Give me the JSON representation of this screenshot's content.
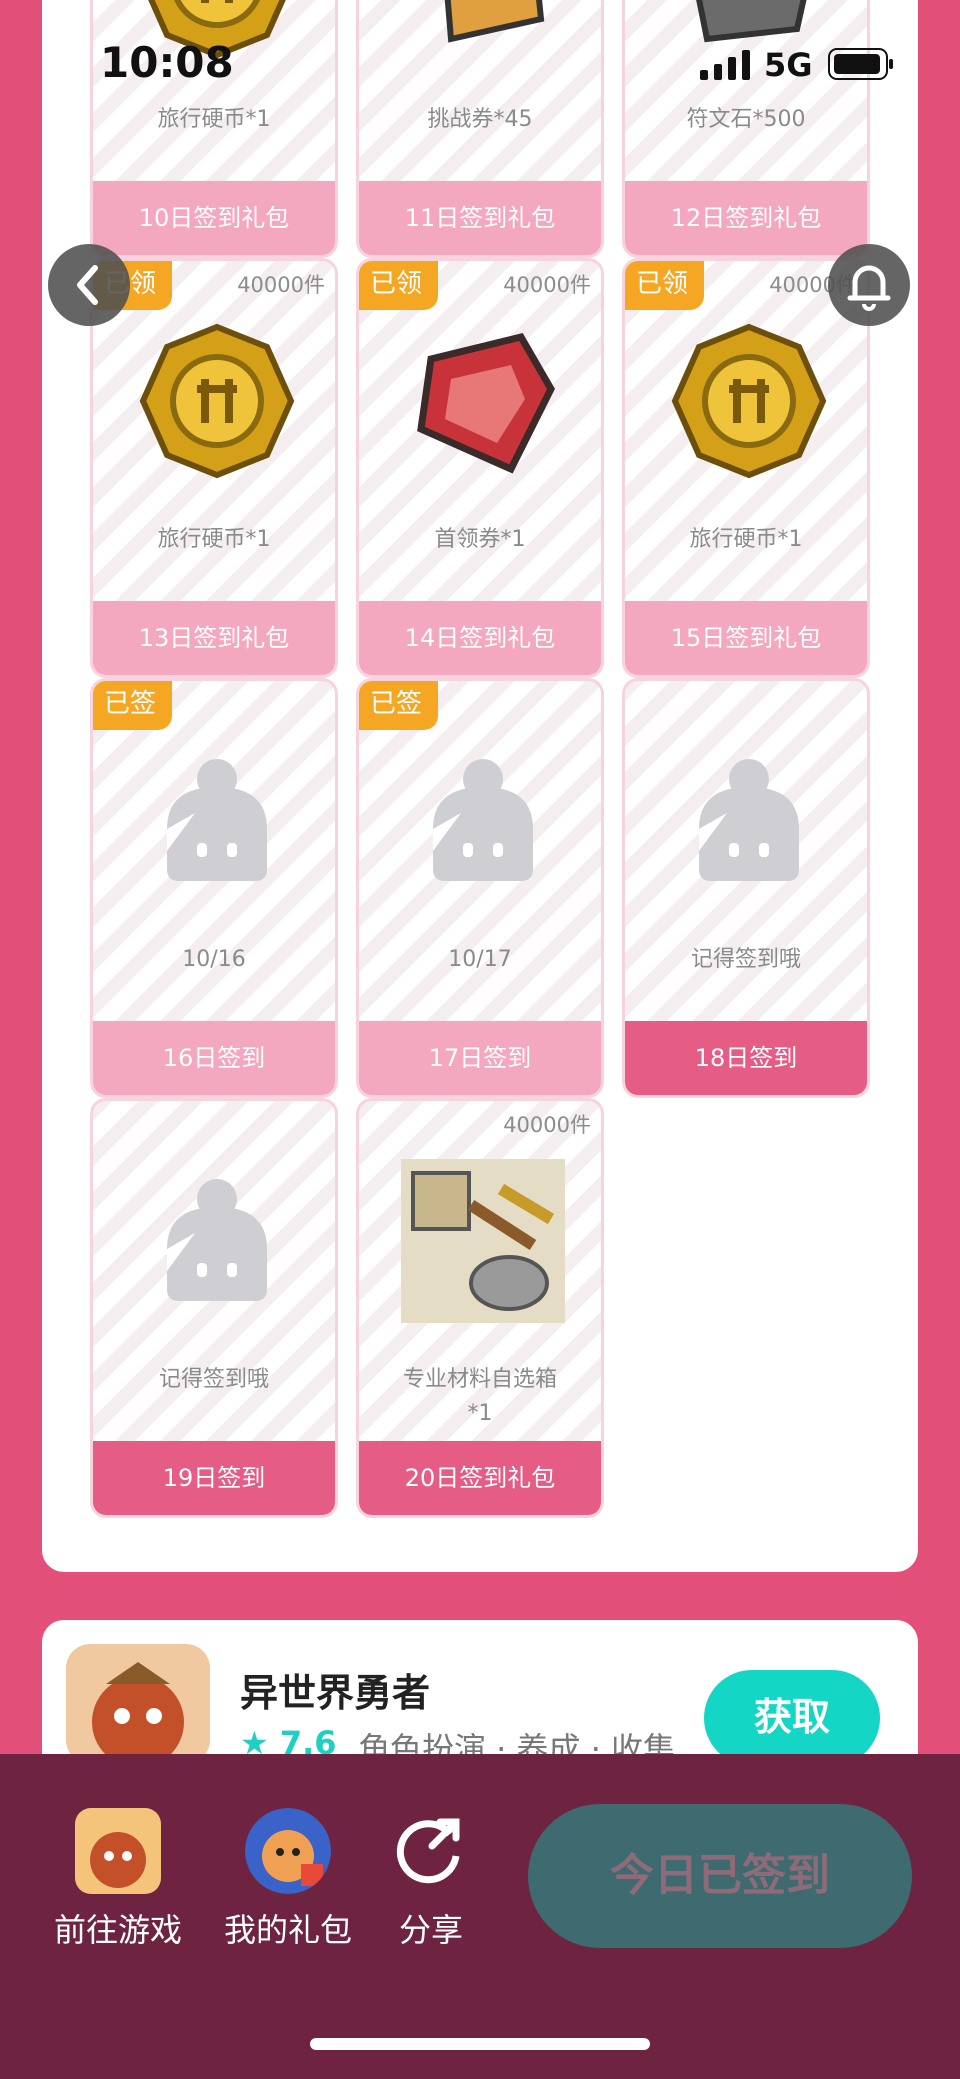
{
  "status_bar": {
    "time": "10:08",
    "network": "5G"
  },
  "rewards": [
    {
      "item": "旅行硬币*1",
      "bar": "10日签到礼包",
      "icon": "coin-icon"
    },
    {
      "item": "挑战券*45",
      "bar": "11日签到礼包",
      "icon": "ticket-icon"
    },
    {
      "item": "符文石*500",
      "bar": "12日签到礼包",
      "icon": "rune-stone-icon"
    },
    {
      "tag": "已领",
      "qty": "40000件",
      "item": "旅行硬币*1",
      "bar": "13日签到礼包",
      "icon": "coin-icon"
    },
    {
      "tag": "已领",
      "qty": "40000件",
      "item": "首领券*1",
      "bar": "14日签到礼包",
      "icon": "boss-ticket-icon"
    },
    {
      "tag": "已领",
      "qty": "40000件",
      "item": "旅行硬币*1",
      "bar": "15日签到礼包",
      "icon": "coin-icon"
    },
    {
      "tag": "已签",
      "item": "10/16",
      "bar": "16日签到",
      "icon": "placeholder-avatar-icon"
    },
    {
      "tag": "已签",
      "item": "10/17",
      "bar": "17日签到",
      "icon": "placeholder-avatar-icon"
    },
    {
      "item": "记得签到哦",
      "bar": "18日签到",
      "icon": "placeholder-avatar-icon",
      "active": true
    },
    {
      "item": "记得签到哦",
      "bar": "19日签到",
      "icon": "placeholder-avatar-icon",
      "active": true
    },
    {
      "qty": "40000件",
      "item": "专业材料自选箱\n*1",
      "bar": "20日签到礼包",
      "icon": "material-box-icon",
      "active": true
    }
  ],
  "game": {
    "name": "异世界勇者",
    "rating": "7.6",
    "tags": "角色扮演 · 养成 · 收集",
    "get_label": "获取"
  },
  "bottom_nav": {
    "go_game": "前往游戏",
    "my_gifts": "我的礼包",
    "share": "分享",
    "signed_label": "今日已签到"
  },
  "colors": {
    "accent_pink": "#e55c85",
    "light_pink": "#f4a8bf",
    "tag_orange": "#f5a623",
    "teal": "#13d6c5",
    "bottom_bg": "#6e2440"
  }
}
